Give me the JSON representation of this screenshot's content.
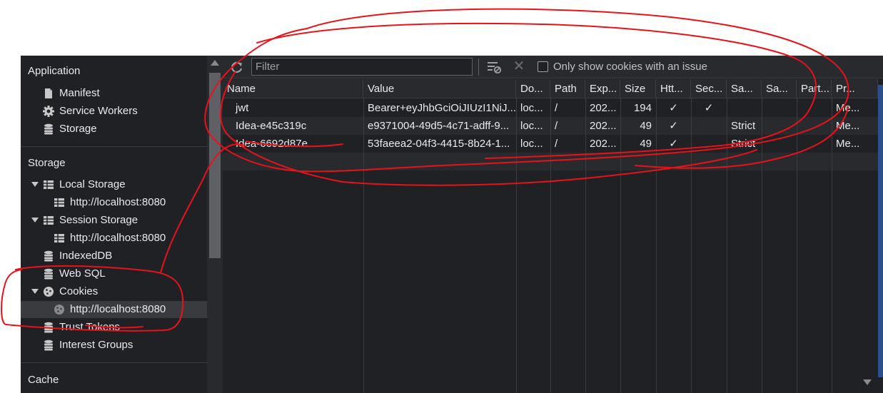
{
  "sidebar": {
    "application_title": "Application",
    "application_items": [
      {
        "label": "Manifest",
        "icon": "file-icon"
      },
      {
        "label": "Service Workers",
        "icon": "gear-icon"
      },
      {
        "label": "Storage",
        "icon": "database-icon"
      }
    ],
    "storage_title": "Storage",
    "local_storage": {
      "label": "Local Storage",
      "child": "http://localhost:8080"
    },
    "session_storage": {
      "label": "Session Storage",
      "child": "http://localhost:8080"
    },
    "indexeddb": "IndexedDB",
    "websql": "Web SQL",
    "cookies": {
      "label": "Cookies",
      "child": "http://localhost:8080"
    },
    "trust_tokens": "Trust Tokens",
    "interest_groups": "Interest Groups",
    "cache_title": "Cache"
  },
  "toolbar": {
    "filter_placeholder": "Filter",
    "only_issue_label": "Only show cookies with an issue",
    "refresh_icon": "refresh-icon",
    "clear_icon": "clear-filtered-icon",
    "delete_icon": "close-icon"
  },
  "table": {
    "headers": [
      "Name",
      "Value",
      "Do...",
      "Path",
      "Exp...",
      "Size",
      "Htt...",
      "Sec...",
      "Sa...",
      "Sa...",
      "Part...",
      "Pr..."
    ],
    "rows": [
      {
        "name": "jwt",
        "value": "Bearer+eyJhbGciOiJIUzI1NiJ...",
        "domain": "loc...",
        "path": "/",
        "expires": "202...",
        "size": "194",
        "httponly": "✓",
        "secure": "✓",
        "samesite": "",
        "sameparty": "",
        "partition": "",
        "priority": "Me..."
      },
      {
        "name": "Idea-e45c319c",
        "value": "e9371004-49d5-4c71-adff-9...",
        "domain": "loc...",
        "path": "/",
        "expires": "202...",
        "size": "49",
        "httponly": "✓",
        "secure": "",
        "samesite": "Strict",
        "sameparty": "",
        "partition": "",
        "priority": "Me..."
      },
      {
        "name": "Idea-6692d87e",
        "value": "53faeea2-04f3-4415-8b24-1...",
        "domain": "loc...",
        "path": "/",
        "expires": "202...",
        "size": "49",
        "httponly": "✓",
        "secure": "",
        "samesite": "Strict",
        "sameparty": "",
        "partition": "",
        "priority": "Me..."
      }
    ]
  },
  "colors": {
    "panel_bg": "#202124",
    "toolbar_bg": "#292a2d",
    "annotation": "#e8121a"
  }
}
